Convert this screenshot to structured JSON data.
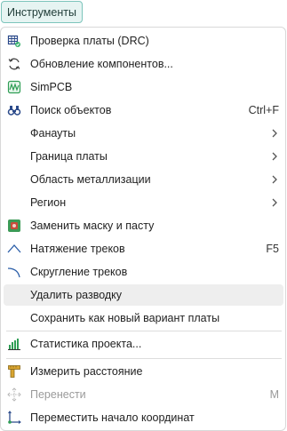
{
  "menubar": {
    "title": "Инструменты"
  },
  "menu": {
    "items": [
      {
        "label": "Проверка платы (DRC)",
        "icon": "drc-grid-icon"
      },
      {
        "label": "Обновление компонентов...",
        "icon": "refresh-icon"
      },
      {
        "label": "SimPCB",
        "icon": "simpcb-icon"
      },
      {
        "label": "Поиск объектов",
        "shortcut": "Ctrl+F",
        "icon": "binoculars-icon"
      },
      {
        "label": "Фанауты",
        "submenu": true
      },
      {
        "label": "Граница платы",
        "submenu": true
      },
      {
        "label": "Область металлизации",
        "submenu": true
      },
      {
        "label": "Регион",
        "submenu": true
      },
      {
        "label": "Заменить маску и пасту",
        "icon": "mask-paste-icon"
      },
      {
        "label": "Натяжение треков",
        "shortcut": "F5",
        "icon": "track-tension-icon"
      },
      {
        "label": "Скругление треков",
        "icon": "track-rounding-icon"
      },
      {
        "label": "Удалить разводку",
        "highlighted": true
      },
      {
        "label": "Сохранить как новый вариант платы"
      },
      {
        "label": "Статистика проекта...",
        "icon": "bar-chart-icon"
      },
      {
        "label": "Измерить расстояние",
        "icon": "ruler-icon"
      },
      {
        "label": "Перенести",
        "shortcut": "M",
        "icon": "move-icon",
        "disabled": true
      },
      {
        "label": "Переместить начало координат",
        "icon": "origin-icon"
      }
    ]
  },
  "colors": {
    "accent": "#2aa198",
    "trigger_bg": "#e6f4f2",
    "hover_bg": "#eeeeee",
    "disabled_text": "#9a9a9a"
  }
}
